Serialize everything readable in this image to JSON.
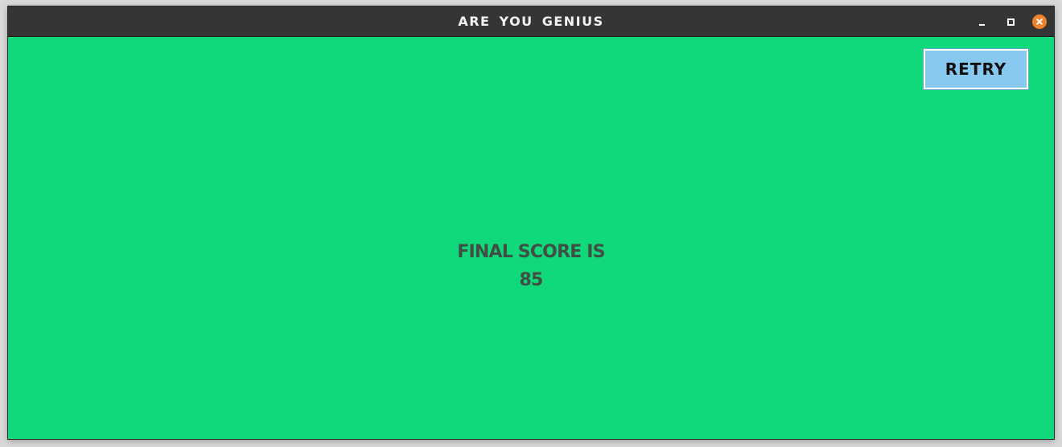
{
  "window": {
    "title": "ARE YOU GENIUS",
    "controls": {
      "minimize_icon": "minimize-icon",
      "maximize_icon": "maximize-icon",
      "close_icon": "close-icon"
    }
  },
  "main": {
    "retry_label": "RETRY",
    "score_label": "FINAL SCORE IS",
    "score_value": "85"
  },
  "colors": {
    "background": "#10d97b",
    "titlebar": "#353535",
    "button": "#87c8ee",
    "close": "#f0832a",
    "score_text": "#3f4f45"
  }
}
